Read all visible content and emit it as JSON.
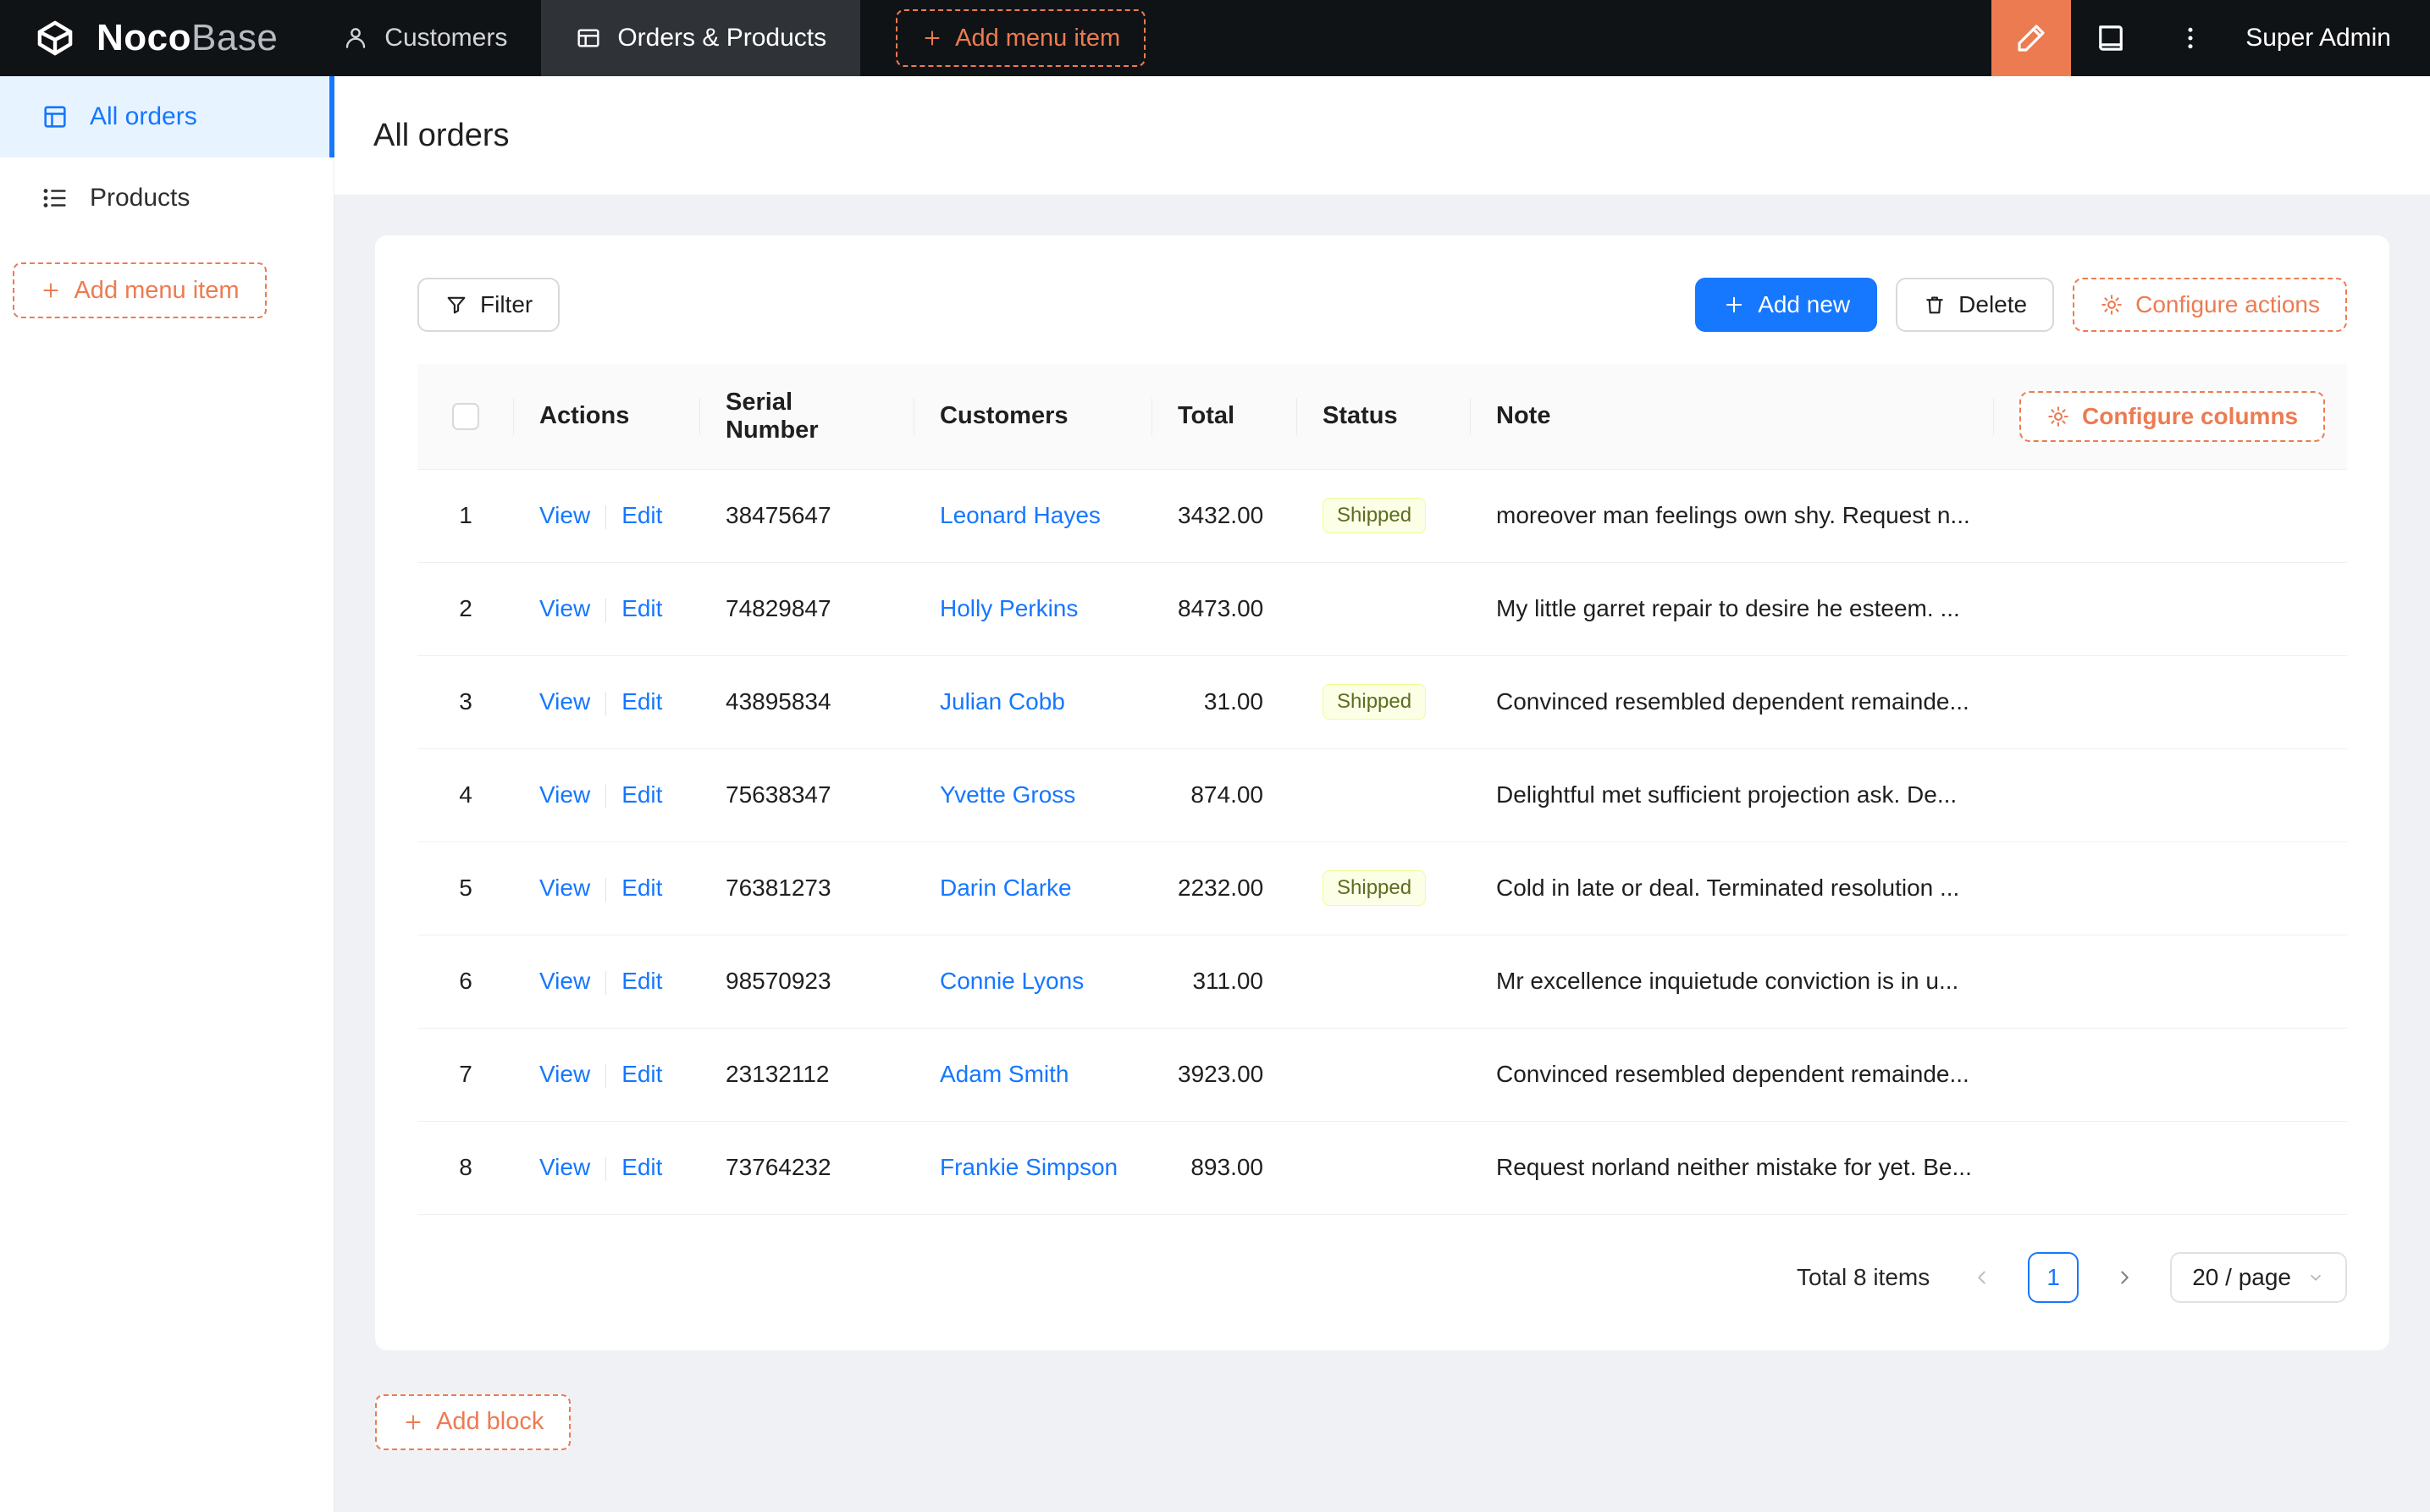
{
  "colors": {
    "accent_orange": "#ed7b51",
    "primary_blue": "#1677ff",
    "topnav_bg": "#101316",
    "active_tab_bg": "#2f3338",
    "sidebar_active_bg": "#e7f4ff",
    "status_tag_bg": "#fcffe6",
    "status_tag_border": "#eaff8f"
  },
  "brand": {
    "noco": "Noco",
    "base": "Base"
  },
  "topnav": {
    "items": [
      {
        "label": "Customers"
      },
      {
        "label": "Orders & Products",
        "active": true
      }
    ],
    "add_menu_item": "Add menu item",
    "user": "Super Admin"
  },
  "sidebar": {
    "items": [
      {
        "label": "All orders",
        "active": true
      },
      {
        "label": "Products"
      }
    ],
    "add_menu_item": "Add menu item"
  },
  "page": {
    "title": "All orders"
  },
  "toolbar": {
    "filter": "Filter",
    "add_new": "Add new",
    "delete": "Delete",
    "configure_actions": "Configure actions"
  },
  "table": {
    "configure_columns": "Configure columns",
    "columns": [
      "Actions",
      "Serial Number",
      "Customers",
      "Total",
      "Status",
      "Note"
    ],
    "action_labels": {
      "view": "View",
      "edit": "Edit"
    },
    "rows": [
      {
        "index": "1",
        "serial": "38475647",
        "customer": "Leonard Hayes",
        "total": "3432.00",
        "status": "Shipped",
        "note": "moreover man feelings own shy. Request n..."
      },
      {
        "index": "2",
        "serial": "74829847",
        "customer": "Holly Perkins",
        "total": "8473.00",
        "status": "",
        "note": "My little garret repair to desire he esteem. ..."
      },
      {
        "index": "3",
        "serial": "43895834",
        "customer": "Julian Cobb",
        "total": "31.00",
        "status": "Shipped",
        "note": "Convinced resembled dependent remainde..."
      },
      {
        "index": "4",
        "serial": "75638347",
        "customer": "Yvette Gross",
        "total": "874.00",
        "status": "",
        "note": "Delightful met sufficient projection ask. De..."
      },
      {
        "index": "5",
        "serial": "76381273",
        "customer": "Darin Clarke",
        "total": "2232.00",
        "status": "Shipped",
        "note": "Cold in late or deal. Terminated resolution ..."
      },
      {
        "index": "6",
        "serial": "98570923",
        "customer": "Connie Lyons",
        "total": "311.00",
        "status": "",
        "note": "Mr excellence inquietude conviction is in u..."
      },
      {
        "index": "7",
        "serial": "23132112",
        "customer": "Adam Smith",
        "total": "3923.00",
        "status": "",
        "note": "Convinced resembled dependent remainde..."
      },
      {
        "index": "8",
        "serial": "73764232",
        "customer": "Frankie Simpson",
        "total": "893.00",
        "status": "",
        "note": "Request norland neither mistake for yet. Be..."
      }
    ]
  },
  "pagination": {
    "total": "Total 8 items",
    "current_page": "1",
    "page_size": "20 / page"
  },
  "add_block": {
    "label": "Add block"
  },
  "icons": {
    "nocobase-logo-icon": "cube",
    "person-icon": "person silhouette",
    "table-icon": "table grid",
    "plus-icon": "+",
    "pen-icon": "highlighter pen",
    "book-icon": "book",
    "kebab-icon": "vertical dots",
    "orders-table-icon": "table grid",
    "list-icon": "bulleted list",
    "filter-icon": "funnel",
    "trash-icon": "trash can",
    "gear-icon": "gear",
    "chevron-left-icon": "chevron left",
    "chevron-right-icon": "chevron right",
    "chevron-down-icon": "chevron down",
    "checkbox": "empty checkbox"
  }
}
